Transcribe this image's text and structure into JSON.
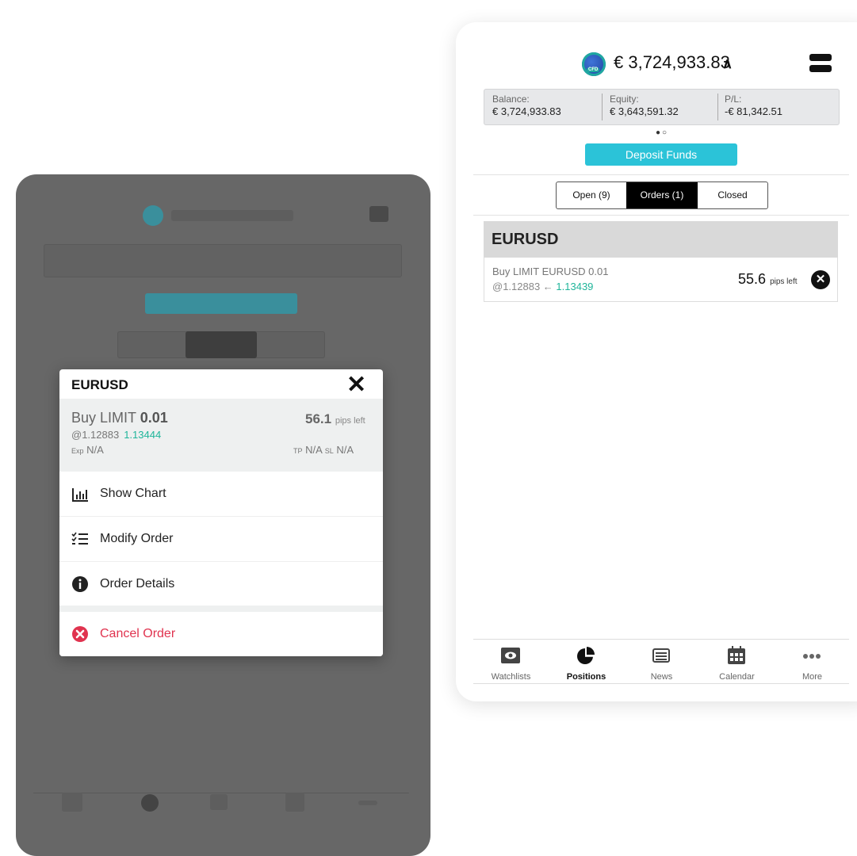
{
  "right_screen": {
    "account": {
      "value": "€ 3,724,933.83",
      "badge": "CFD"
    },
    "stats": {
      "balance_label": "Balance:",
      "balance_value": "€ 3,724,933.83",
      "equity_label": "Equity:",
      "equity_value": "€ 3,643,591.32",
      "pl_label": "P/L:",
      "pl_value": "-€ 81,342.51"
    },
    "deposit_label": "Deposit Funds",
    "segments": [
      "Open (9)",
      "Orders (1)",
      "Closed"
    ],
    "active_segment": "Orders (1)",
    "symbol": "EURUSD",
    "order": {
      "line1": "Buy LIMIT EURUSD 0.01",
      "at_price": "@1.12883 ← ",
      "current_price": "1.13439",
      "pips": "55.6",
      "pips_unit": "pips left"
    },
    "tabs": [
      {
        "label": "Watchlists",
        "icon": "eye-icon"
      },
      {
        "label": "Positions",
        "icon": "pie-chart-icon"
      },
      {
        "label": "News",
        "icon": "newspaper-icon"
      },
      {
        "label": "Calendar",
        "icon": "calendar-icon"
      },
      {
        "label": "More",
        "icon": "more-dots-icon"
      }
    ],
    "active_tab": "Positions"
  },
  "modal": {
    "title": "EURUSD",
    "order_type": "Buy LIMIT ",
    "volume": "0.01",
    "pips": "56.1",
    "pips_unit": "pips left",
    "at_price": "@1.12883",
    "current_price": "1.13444",
    "exp_label": "Exp",
    "exp_value": "N/A",
    "tp_label": "TP",
    "tp_value": "N/A",
    "sl_label": "SL",
    "sl_value": "N/A",
    "actions": [
      {
        "label": "Show Chart",
        "icon": "bar-chart-icon"
      },
      {
        "label": "Modify Order",
        "icon": "checklist-icon"
      },
      {
        "label": "Order Details",
        "icon": "info-icon"
      },
      {
        "label": "Cancel Order",
        "icon": "cancel-icon"
      }
    ]
  },
  "colors": {
    "accent": "#2bc3d8",
    "green": "#1fb59a",
    "danger": "#e0334f",
    "overlay": "#676767"
  }
}
